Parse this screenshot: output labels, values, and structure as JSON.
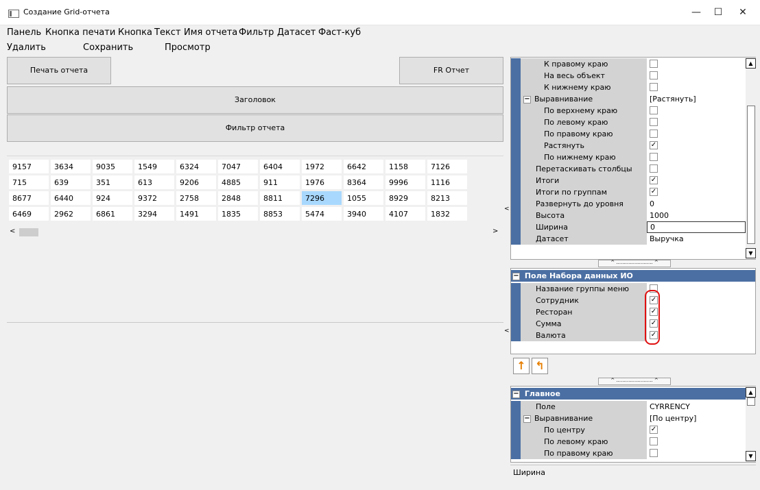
{
  "window": {
    "title": "Создание Grid-отчета",
    "minimize": "—",
    "maximize": "☐",
    "close": "✕"
  },
  "menu": [
    "Панель",
    "Кнопка печати",
    "Кнопка",
    "Текст",
    "Имя отчета",
    "Фильтр",
    "Датасет",
    "Фаст-куб"
  ],
  "toolbar": {
    "delete": "Удалить",
    "save": "Сохранить",
    "preview": "Просмотр"
  },
  "report": {
    "print_button": "Печать отчета",
    "fr_button": "FR Отчет",
    "header": "Заголовок",
    "filter": "Фильтр отчета"
  },
  "grid": {
    "rows": [
      [
        "9157",
        "3634",
        "9035",
        "1549",
        "6324",
        "7047",
        "6404",
        "1972",
        "6642",
        "1158",
        "7126"
      ],
      [
        "715",
        "639",
        "351",
        "613",
        "9206",
        "4885",
        "911",
        "1976",
        "8364",
        "9996",
        "1116"
      ],
      [
        "8677",
        "6440",
        "924",
        "9372",
        "2758",
        "2848",
        "8811",
        "7296",
        "1055",
        "8929",
        "8213"
      ],
      [
        "6469",
        "2962",
        "6861",
        "3294",
        "1491",
        "1835",
        "8853",
        "5474",
        "3940",
        "4107",
        "1832"
      ]
    ],
    "selected": {
      "row": 2,
      "col": 7
    }
  },
  "props1": {
    "rows": [
      {
        "name": "К правому краю",
        "value": "",
        "check": false,
        "indent": 2
      },
      {
        "name": "На весь объект",
        "value": "",
        "check": false,
        "indent": 2
      },
      {
        "name": "К нижнему краю",
        "value": "",
        "check": false,
        "indent": 2
      },
      {
        "name": "Выравнивание",
        "value": "[Растянуть]",
        "group": true,
        "indent": 1
      },
      {
        "name": "По верхнему краю",
        "value": "",
        "check": false,
        "indent": 2
      },
      {
        "name": "По левому краю",
        "value": "",
        "check": false,
        "indent": 2
      },
      {
        "name": "По правому краю",
        "value": "",
        "check": false,
        "indent": 2
      },
      {
        "name": "Растянуть",
        "value": "",
        "check": true,
        "indent": 2
      },
      {
        "name": "По нижнему краю",
        "value": "",
        "check": false,
        "indent": 2
      },
      {
        "name": "Перетаскивать столбцы",
        "value": "",
        "check": false,
        "indent": 1
      },
      {
        "name": "Итоги",
        "value": "",
        "check": true,
        "indent": 1
      },
      {
        "name": "Итоги по группам",
        "value": "",
        "check": true,
        "indent": 1
      },
      {
        "name": "Развернуть до уровня",
        "value": "0",
        "indent": 1
      },
      {
        "name": "Высота",
        "value": "1000",
        "indent": 1
      },
      {
        "name": "Ширина",
        "value": "0",
        "indent": 1,
        "editing": true
      },
      {
        "name": "Датасет",
        "value": "Выручка",
        "indent": 1
      }
    ]
  },
  "props2": {
    "header": "Поле Набора данных ИО",
    "rows": [
      {
        "name": "Название группы меню",
        "check": false
      },
      {
        "name": "Сотрудник",
        "check": true
      },
      {
        "name": "Ресторан",
        "check": true
      },
      {
        "name": "Сумма",
        "check": true
      },
      {
        "name": "Валюта",
        "check": true
      }
    ],
    "up_icon": "↑",
    "back_icon": "↰"
  },
  "props3": {
    "header": "Главное",
    "rows": [
      {
        "name": "Поле",
        "value": "CYRRENCY",
        "indent": 1
      },
      {
        "name": "Выравнивание",
        "value": "[По центру]",
        "group": true,
        "indent": 1
      },
      {
        "name": "По центру",
        "value": "",
        "check": true,
        "indent": 2
      },
      {
        "name": "По левому краю",
        "value": "",
        "check": false,
        "indent": 2
      },
      {
        "name": "По правому краю",
        "value": "",
        "check": false,
        "indent": 2
      }
    ],
    "description": "Ширина"
  },
  "colors": {
    "accent": "#4b6fa3",
    "selected_cell": "#a8d8fd",
    "highlight": "#e01010"
  }
}
